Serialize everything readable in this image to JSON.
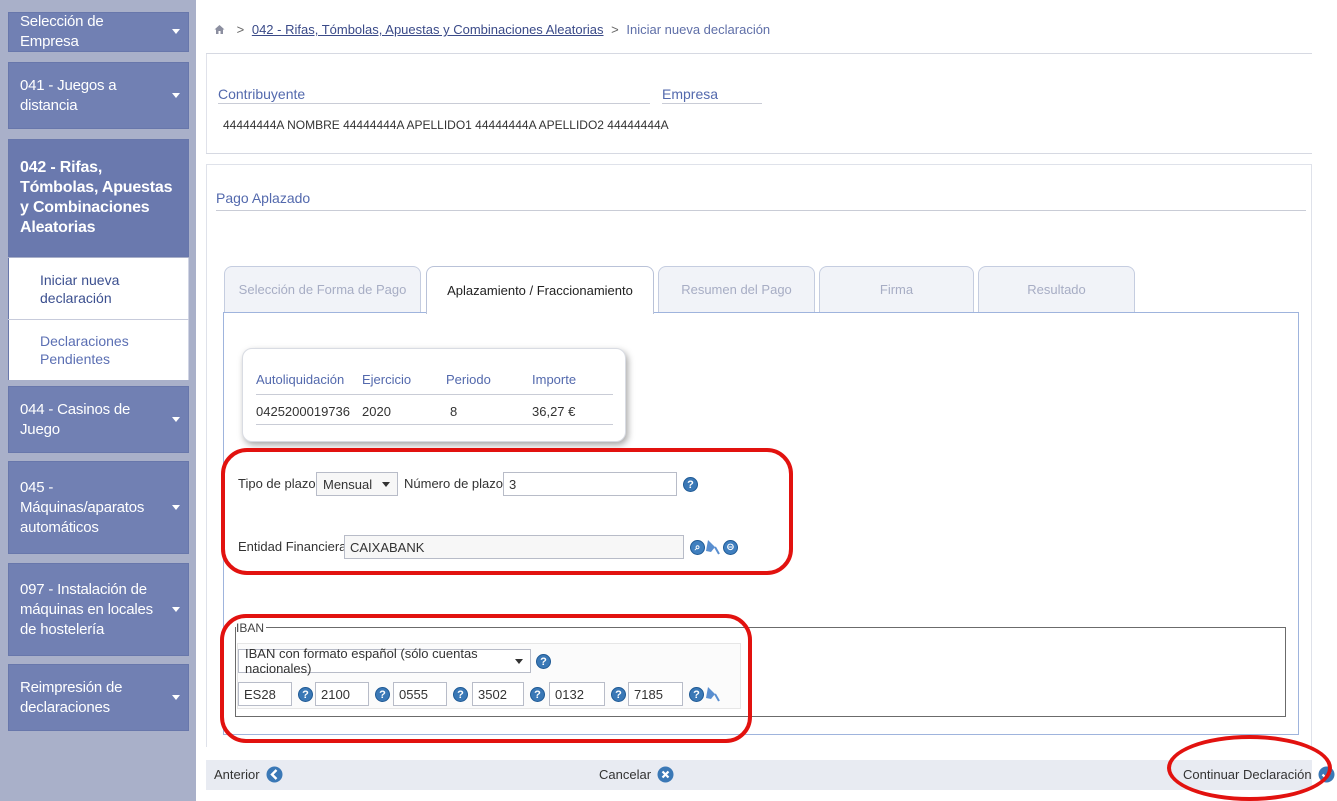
{
  "sidebar": {
    "company_selector": "Selección de Empresa",
    "menus": [
      {
        "label": "041 - Juegos a distancia"
      },
      {
        "label": "042 - Rifas, Tómbolas, Apuestas y Combinaciones Aleatorias"
      },
      {
        "label": "044 - Casinos de Juego"
      },
      {
        "label": "045 - Máquinas/aparatos automáticos"
      },
      {
        "label": "097 - Instalación de máquinas en locales de hostelería"
      },
      {
        "label": "Reimpresión de declaraciones"
      }
    ],
    "submenu": [
      "Iniciar nueva declaración",
      "Declaraciones Pendientes"
    ]
  },
  "breadcrumb": {
    "separator": ">",
    "parent": "042 - Rifas, Tómbolas, Apuestas y Combinaciones Aleatorias",
    "current": "Iniciar nueva declaración"
  },
  "identity": {
    "contribuyente_label": "Contribuyente",
    "empresa_label": "Empresa",
    "contribuyente_value": "44444444A NOMBRE 44444444A APELLIDO1 44444444A APELLIDO2 44444444A"
  },
  "payment": {
    "section_title": "Pago Aplazado",
    "tabs": [
      {
        "label": "Selección de Forma de Pago"
      },
      {
        "label": "Aplazamiento / Fraccionamiento"
      },
      {
        "label": "Resumen del Pago"
      },
      {
        "label": "Firma"
      },
      {
        "label": "Resultado"
      }
    ],
    "summary": {
      "headers": [
        "Autoliquidación",
        "Ejercicio",
        "Periodo",
        "Importe"
      ],
      "row": [
        "0425200019736",
        "2020",
        "8",
        "36,27 €"
      ]
    },
    "tipo_plazo_label": "Tipo de plazo:",
    "tipo_plazo_value": "Mensual",
    "num_plazos_label": "Número de plazos:",
    "num_plazos_value": "3",
    "entidad_label": "Entidad Financiera:",
    "entidad_value": "CAIXABANK",
    "iban": {
      "legend": "IBAN",
      "format_value": "IBAN con formato español (sólo cuentas nacionales)",
      "fields": [
        "ES28",
        "2100",
        "0555",
        "3502",
        "0132",
        "7185"
      ]
    }
  },
  "footer": {
    "previous": "Anterior",
    "cancel": "Cancelar",
    "continue": "Continuar Declaración"
  },
  "icons": {
    "help": "?",
    "search": "⌕",
    "add": "⊖"
  },
  "colors": {
    "sidebar_bg": "#a9b0c9",
    "menu_bg": "#7180b3",
    "accent_link": "#5369ad",
    "highlight_ring": "#e2120f"
  }
}
